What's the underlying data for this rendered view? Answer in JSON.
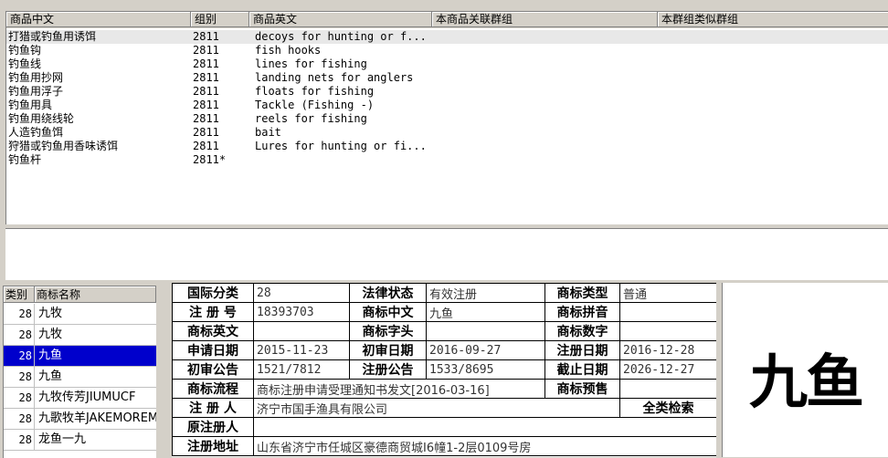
{
  "goods_table": {
    "columns": [
      "商品中文",
      "组别",
      "商品英文",
      "本商品关联群组",
      "本群组类似群组"
    ],
    "rows": [
      {
        "cn": "打猎或钓鱼用诱饵",
        "group": "2811",
        "en": "decoys for hunting or f..."
      },
      {
        "cn": "钓鱼钩",
        "group": "2811",
        "en": "fish hooks"
      },
      {
        "cn": "钓鱼线",
        "group": "2811",
        "en": "lines for fishing"
      },
      {
        "cn": "钓鱼用抄网",
        "group": "2811",
        "en": "landing nets for anglers"
      },
      {
        "cn": "钓鱼用浮子",
        "group": "2811",
        "en": "floats for fishing"
      },
      {
        "cn": "钓鱼用具",
        "group": "2811",
        "en": "Tackle (Fishing -)"
      },
      {
        "cn": "钓鱼用绕线轮",
        "group": "2811",
        "en": "reels for fishing"
      },
      {
        "cn": "人造钓鱼饵",
        "group": "2811",
        "en": "bait"
      },
      {
        "cn": "狩猎或钓鱼用香味诱饵",
        "group": "2811",
        "en": "Lures for hunting or fi..."
      },
      {
        "cn": "钓鱼杆",
        "group": "2811*",
        "en": ""
      }
    ]
  },
  "trademark_list": {
    "columns": [
      "类别",
      "商标名称"
    ],
    "rows": [
      {
        "cls": "28",
        "name": "九牧"
      },
      {
        "cls": "28",
        "name": "九牧"
      },
      {
        "cls": "28",
        "name": "九鱼"
      },
      {
        "cls": "28",
        "name": "九鱼"
      },
      {
        "cls": "28",
        "name": "九牧传芳JIUMUCF"
      },
      {
        "cls": "28",
        "name": "九歌牧羊JAKEMOREM"
      },
      {
        "cls": "28",
        "name": "龙鱼一九"
      }
    ],
    "selected_index": 2
  },
  "detail": {
    "intl_class_label": "国际分类",
    "intl_class": "28",
    "legal_status_label": "法律状态",
    "legal_status": "有效注册",
    "tm_type_label": "商标类型",
    "tm_type": "普通",
    "reg_no_label": "注 册 号",
    "reg_no": "18393703",
    "tm_cn_label": "商标中文",
    "tm_cn": "九鱼",
    "tm_pinyin_label": "商标拼音",
    "tm_pinyin": "",
    "tm_en_label": "商标英文",
    "tm_en": "",
    "tm_head_label": "商标字头",
    "tm_head": "",
    "tm_digit_label": "商标数字",
    "tm_digit": "",
    "apply_date_label": "申请日期",
    "apply_date": "2015-11-23",
    "prelim_date_label": "初审日期",
    "prelim_date": "2016-09-27",
    "reg_date_label": "注册日期",
    "reg_date": "2016-12-28",
    "prelim_pub_label": "初审公告",
    "prelim_pub": "1521/7812",
    "reg_pub_label": "注册公告",
    "reg_pub": "1533/8695",
    "expire_label": "截止日期",
    "expire": "2026-12-27",
    "flow_label": "商标流程",
    "flow": "商标注册申请受理通知书发文[2016-03-16]",
    "presale_label": "商标预售",
    "presale": "",
    "registrant_label": "注 册 人",
    "registrant": "济宁市国手渔具有限公司",
    "search_all_label": "全类检索",
    "orig_registrant_label": "原注册人",
    "orig_registrant": "",
    "address_label": "注册地址",
    "address": "山东省济宁市任城区豪德商贸城I6幢1-2层0109号房"
  },
  "logo": {
    "text": "九鱼"
  }
}
